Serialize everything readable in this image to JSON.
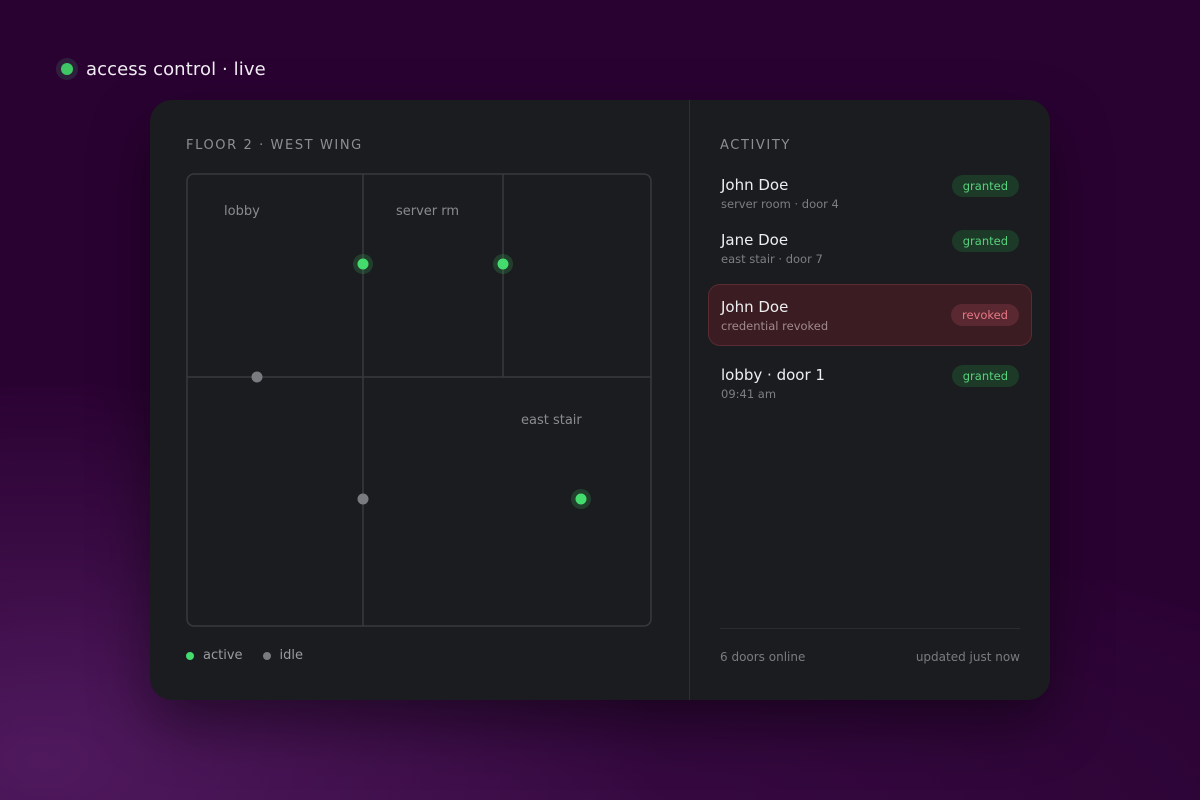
{
  "header": {
    "status_label": "access control · live",
    "status_color": "#3fc765"
  },
  "map": {
    "title": "FLOOR 2 · WEST WING",
    "rooms": [
      "lobby",
      "server rm",
      "east stair"
    ],
    "doors": [
      {
        "status": "active"
      },
      {
        "status": "active"
      },
      {
        "status": "idle"
      },
      {
        "status": "idle"
      },
      {
        "status": "active"
      }
    ],
    "legend": {
      "active_label": "active",
      "idle_label": "idle",
      "active_color": "#45dc6e",
      "idle_color": "#7a7b80"
    }
  },
  "activity": {
    "title": "ACTIVITY",
    "items": [
      {
        "name": "John Doe",
        "detail": "server room · door 4",
        "status": "granted"
      },
      {
        "name": "Jane Doe",
        "detail": "east stair · door 7",
        "status": "granted"
      },
      {
        "name": "John Doe",
        "detail": "credential revoked",
        "status": "revoked"
      },
      {
        "name": "lobby · door 1",
        "detail": "09:41 am",
        "status": "granted"
      }
    ],
    "footer": {
      "doors_online": "6 doors online",
      "updated": "updated just now"
    },
    "colors": {
      "granted": "#59d07c",
      "revoked": "#e77886"
    }
  }
}
